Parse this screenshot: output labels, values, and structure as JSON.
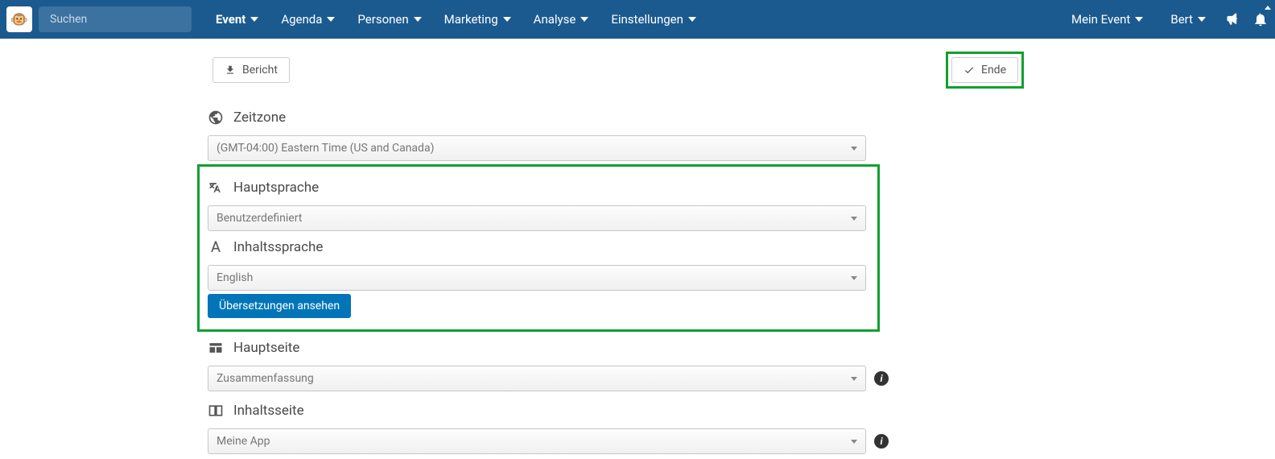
{
  "search": {
    "placeholder": "Suchen"
  },
  "nav": {
    "items": [
      "Event",
      "Agenda",
      "Personen",
      "Marketing",
      "Analyse",
      "Einstellungen"
    ],
    "activeIndex": 0
  },
  "rightNav": {
    "myEvent": "Mein Event",
    "user": "Bert"
  },
  "actions": {
    "report": "Bericht",
    "finish": "Ende"
  },
  "sections": {
    "timezone": {
      "label": "Zeitzone",
      "value": "(GMT-04:00) Eastern Time (US and Canada)"
    },
    "mainLanguage": {
      "label": "Hauptsprache",
      "value": "Benutzerdefiniert"
    },
    "contentLanguage": {
      "label": "Inhaltssprache",
      "value": "English",
      "translationsBtn": "Übersetzungen ansehen"
    },
    "mainPage": {
      "label": "Hauptseite",
      "value": "Zusammenfassung"
    },
    "contentPage": {
      "label": "Inhaltsseite",
      "value": "Meine App"
    }
  }
}
